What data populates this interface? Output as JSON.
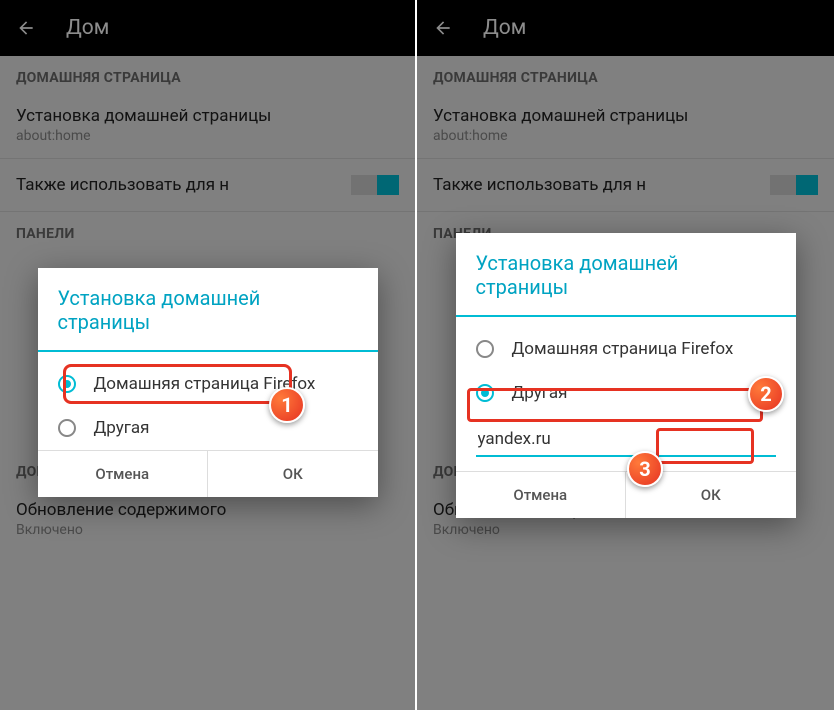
{
  "header": {
    "title": "Дом"
  },
  "sections": {
    "homepage": "ДОМАШНЯЯ СТРАНИЦА",
    "panels": "ПАНЕЛИ",
    "addons": "ДОПОЛНЕНИЯ"
  },
  "items": {
    "set_home": {
      "title": "Установка домашней страницы",
      "sub": "about:home"
    },
    "also_use": "Также использовать для н",
    "update": {
      "title": "Обновление содержимого",
      "sub": "Включено"
    }
  },
  "dialog": {
    "title": "Установка домашней страницы",
    "opt_firefox": "Домашняя страница Firefox",
    "opt_other": "Другая",
    "input_value": "yandex.ru",
    "cancel": "Отмена",
    "ok": "ОК"
  },
  "badges": {
    "b1": "1",
    "b2": "2",
    "b3": "3"
  }
}
